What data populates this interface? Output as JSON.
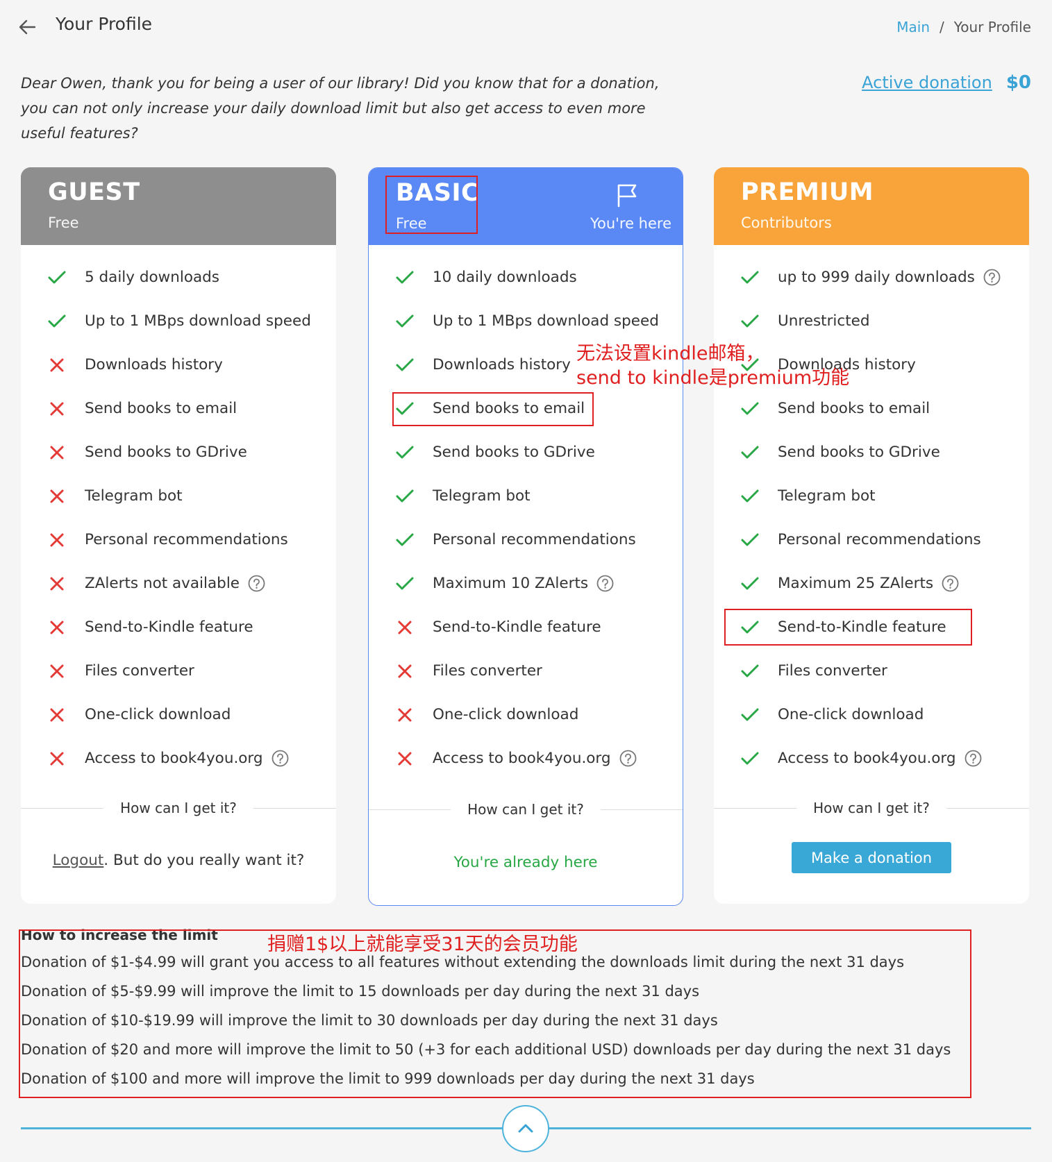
{
  "header": {
    "title": "Your Profile",
    "breadcrumb": {
      "main": "Main",
      "separator": "/",
      "current": "Your Profile"
    }
  },
  "intro": {
    "line1": "Dear Owen, thank you for being a user of our library! Did you know that for a donation,",
    "line2": "you can not only increase your daily download limit but also get access to even more",
    "line3": "useful features?"
  },
  "active_donation": {
    "label": "Active donation",
    "amount": "$0"
  },
  "colors": {
    "guest": "#8e8e8e",
    "basic": "#5a88f4",
    "premium": "#f9a43a",
    "check": "#28a745",
    "cross": "#e53935",
    "accent": "#3aa3d6",
    "annotation": "#e02020"
  },
  "plans": {
    "guest": {
      "name": "GUEST",
      "subtitle": "Free",
      "features": [
        {
          "label": "5 daily downloads",
          "included": true
        },
        {
          "label": "Up to 1 MBps download speed",
          "included": true
        },
        {
          "label": "Downloads history",
          "included": false
        },
        {
          "label": "Send books to email",
          "included": false
        },
        {
          "label": "Send books to GDrive",
          "included": false
        },
        {
          "label": "Telegram bot",
          "included": false
        },
        {
          "label": "Personal recommendations",
          "included": false
        },
        {
          "label": "ZAlerts not available",
          "included": false,
          "help": true
        },
        {
          "label": "Send-to-Kindle feature",
          "included": false
        },
        {
          "label": "Files converter",
          "included": false
        },
        {
          "label": "One-click download",
          "included": false
        },
        {
          "label": "Access to book4you.org",
          "included": false,
          "help": true
        }
      ],
      "how": "How can I get it?",
      "logout_link": "Logout",
      "logout_suffix": ". But do you really want it?"
    },
    "basic": {
      "name": "BASIC",
      "subtitle": "Free",
      "here_label": "You're here",
      "icon": "flag-icon",
      "features": [
        {
          "label": "10 daily downloads",
          "included": true
        },
        {
          "label": "Up to 1 MBps download speed",
          "included": true
        },
        {
          "label": "Downloads history",
          "included": true
        },
        {
          "label": "Send books to email",
          "included": true
        },
        {
          "label": "Send books to GDrive",
          "included": true
        },
        {
          "label": "Telegram bot",
          "included": true
        },
        {
          "label": "Personal recommendations",
          "included": true
        },
        {
          "label": "Maximum 10 ZAlerts",
          "included": true,
          "help": true
        },
        {
          "label": "Send-to-Kindle feature",
          "included": false
        },
        {
          "label": "Files converter",
          "included": false
        },
        {
          "label": "One-click download",
          "included": false
        },
        {
          "label": "Access to book4you.org",
          "included": false,
          "help": true
        }
      ],
      "how": "How can I get it?",
      "status": "You're already here"
    },
    "premium": {
      "name": "PREMIUM",
      "subtitle": "Contributors",
      "features": [
        {
          "label": "up to 999 daily downloads",
          "included": true,
          "help": true
        },
        {
          "label": "Unrestricted",
          "included": true
        },
        {
          "label": "Downloads history",
          "included": true
        },
        {
          "label": "Send books to email",
          "included": true
        },
        {
          "label": "Send books to GDrive",
          "included": true
        },
        {
          "label": "Telegram bot",
          "included": true
        },
        {
          "label": "Personal recommendations",
          "included": true
        },
        {
          "label": "Maximum 25 ZAlerts",
          "included": true,
          "help": true
        },
        {
          "label": "Send-to-Kindle feature",
          "included": true
        },
        {
          "label": "Files converter",
          "included": true
        },
        {
          "label": "One-click download",
          "included": true
        },
        {
          "label": "Access to book4you.org",
          "included": true,
          "help": true
        }
      ],
      "how": "How can I get it?",
      "button": "Make a donation"
    }
  },
  "limits": {
    "title": "How to increase the limit",
    "items": [
      "Donation of $1-$4.99 will grant you access to all features without extending the downloads limit during the next 31 days",
      "Donation of $5-$9.99 will improve the limit to 15 downloads per day during the next 31 days",
      "Donation of $10-$19.99 will improve the limit to 30 downloads per day during the next 31 days",
      "Donation of $20 and more will improve the limit to 50 (+3 for each additional USD) downloads per day during the next 31 days",
      "Donation of $100 and more will improve the limit to 999 downloads per day during the next 31 days"
    ]
  },
  "annotations": {
    "kindle_note_line1": "无法设置kindle邮箱，",
    "kindle_note_line2": "send to kindle是premium功能",
    "donation_note": "捐赠1$以上就能享受31天的会员功能"
  }
}
